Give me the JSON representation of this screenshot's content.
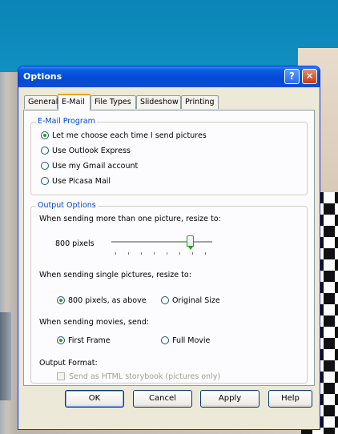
{
  "window": {
    "title": "Options"
  },
  "titlebar": {
    "help_glyph": "?",
    "close_glyph": "✕"
  },
  "tabs": [
    {
      "label": "General",
      "active": false
    },
    {
      "label": "E-Mail",
      "active": true
    },
    {
      "label": "File Types",
      "active": false
    },
    {
      "label": "Slideshow",
      "active": false
    },
    {
      "label": "Printing",
      "active": false
    }
  ],
  "email_program": {
    "legend": "E-Mail Program",
    "options": [
      {
        "label": "Let me choose each time I send pictures",
        "checked": true
      },
      {
        "label": "Use Outlook Express",
        "checked": false
      },
      {
        "label": "Use my Gmail account",
        "checked": false
      },
      {
        "label": "Use Picasa Mail",
        "checked": false
      }
    ]
  },
  "output_options": {
    "legend": "Output Options",
    "multi_resize_label": "When sending more than one picture, resize to:",
    "slider_value": "800 pixels",
    "slider_level": 0.8,
    "single_resize_label": "When sending single pictures, resize to:",
    "single_options": [
      {
        "label": "800 pixels, as above",
        "checked": true
      },
      {
        "label": "Original Size",
        "checked": false
      }
    ],
    "movies_label": "When sending movies, send:",
    "movie_options": [
      {
        "label": "First Frame",
        "checked": true
      },
      {
        "label": "Full Movie",
        "checked": false
      }
    ],
    "format_label": "Output Format:",
    "storybook_label": "Send as HTML storybook (pictures only)",
    "storybook_checked": false
  },
  "buttons": {
    "ok": "OK",
    "cancel": "Cancel",
    "apply": "Apply",
    "help": "Help"
  }
}
